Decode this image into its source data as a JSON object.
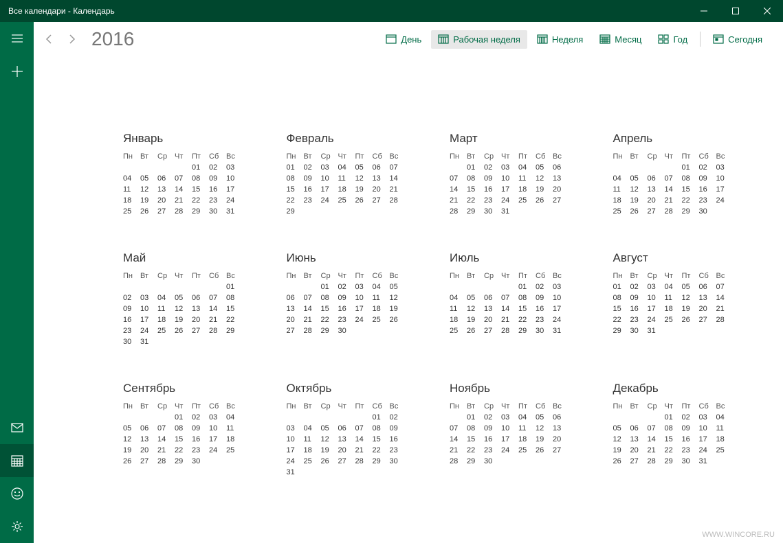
{
  "window": {
    "title": "Все календари - Календарь"
  },
  "toolbar": {
    "year": "2016",
    "views": {
      "day": "День",
      "workweek": "Рабочая неделя",
      "week": "Неделя",
      "month": "Месяц",
      "year": "Год",
      "today": "Сегодня"
    },
    "active_view": "workweek"
  },
  "weekdays": [
    "Пн",
    "Вт",
    "Ср",
    "Чт",
    "Пт",
    "Сб",
    "Вс"
  ],
  "months": [
    {
      "name": "Январь",
      "start": 4,
      "days": 31
    },
    {
      "name": "Февраль",
      "start": 0,
      "days": 29
    },
    {
      "name": "Март",
      "start": 1,
      "days": 31
    },
    {
      "name": "Апрель",
      "start": 4,
      "days": 30
    },
    {
      "name": "Май",
      "start": 6,
      "days": 31
    },
    {
      "name": "Июнь",
      "start": 2,
      "days": 30
    },
    {
      "name": "Июль",
      "start": 4,
      "days": 31
    },
    {
      "name": "Август",
      "start": 0,
      "days": 31
    },
    {
      "name": "Сентябрь",
      "start": 3,
      "days": 30
    },
    {
      "name": "Октябрь",
      "start": 5,
      "days": 31
    },
    {
      "name": "Ноябрь",
      "start": 1,
      "days": 30
    },
    {
      "name": "Декабрь",
      "start": 3,
      "days": 31
    }
  ],
  "watermark": "WWW.WINCORE.RU"
}
